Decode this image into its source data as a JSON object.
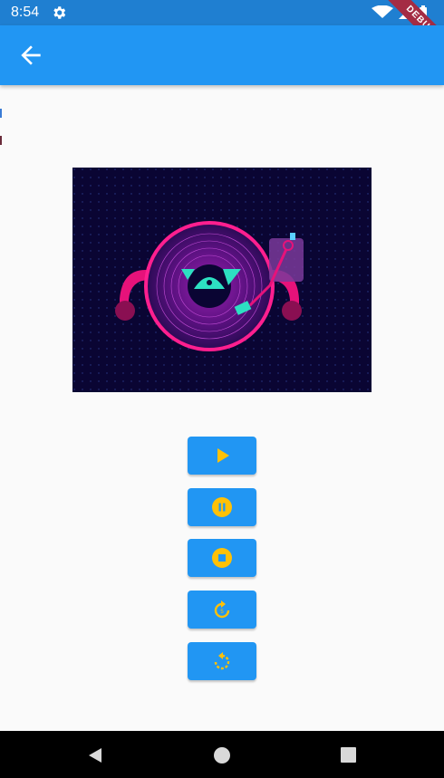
{
  "status_bar": {
    "time": "8:54",
    "icons": [
      "settings-icon",
      "wifi-icon",
      "signal-icon",
      "battery-icon"
    ],
    "debug_banner": "DEBUG",
    "color": "#1f7fd1"
  },
  "app_bar": {
    "back_icon": "arrow-back-icon",
    "color": "#2196f3"
  },
  "artwork": {
    "description_icon": "turntable-illustration",
    "background": "#0a0533"
  },
  "controls": {
    "button_color": "#2196f3",
    "icon_color": "#ffc107",
    "buttons": [
      {
        "name": "play",
        "icon": "play-icon"
      },
      {
        "name": "pause",
        "icon": "pause-circle-icon"
      },
      {
        "name": "stop",
        "icon": "stop-circle-icon"
      },
      {
        "name": "forward",
        "icon": "forward-icon"
      },
      {
        "name": "replay",
        "icon": "replay-icon"
      }
    ]
  },
  "nav_bar": {
    "items": [
      "back",
      "home",
      "recents"
    ]
  }
}
